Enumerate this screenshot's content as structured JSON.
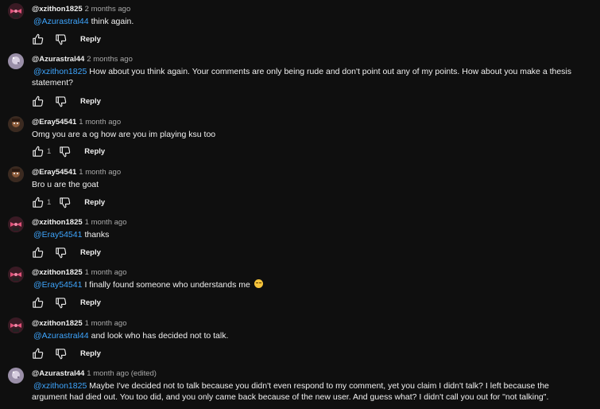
{
  "comments": [
    {
      "author": "@xzithon1825",
      "time": "2 months ago",
      "mention": "@Azurastral44",
      "text": "think again.",
      "likes": "",
      "reply": "Reply",
      "avatar": "pink-bow-avatar"
    },
    {
      "author": "@Azurastral44",
      "time": "2 months ago",
      "mention": "@xzithon1825",
      "text": "How about you think again. Your comments are only being rude and don't point out any of my points. How about you make a thesis statement?",
      "likes": "",
      "reply": "Reply",
      "avatar": "galaxy-avatar"
    },
    {
      "author": "@Eray54541",
      "time": "1 month ago",
      "mention": "",
      "text": "Omg you are a og how are you im playing ksu too",
      "likes": "1",
      "reply": "Reply",
      "avatar": "brown-character-avatar"
    },
    {
      "author": "@Eray54541",
      "time": "1 month ago",
      "mention": "",
      "text": "Bro u are the goat",
      "likes": "1",
      "reply": "Reply",
      "avatar": "brown-character-avatar"
    },
    {
      "author": "@xzithon1825",
      "time": "1 month ago",
      "mention": "@Eray54541",
      "text": "thanks",
      "likes": "",
      "reply": "Reply",
      "avatar": "pink-bow-avatar"
    },
    {
      "author": "@xzithon1825",
      "time": "1 month ago",
      "mention": "@Eray54541",
      "text": "I finally found someone who understands me",
      "emoji": "relieved-face-emoji",
      "likes": "",
      "reply": "Reply",
      "avatar": "pink-bow-avatar"
    },
    {
      "author": "@xzithon1825",
      "time": "1 month ago",
      "mention": "@Azurastral44",
      "text": "and look who has decided not to talk.",
      "likes": "",
      "reply": "Reply",
      "avatar": "pink-bow-avatar"
    },
    {
      "author": "@Azurastral44",
      "time": "1 month ago (edited)",
      "mention": "@xzithon1825",
      "text": "Maybe I've decided not to talk because you didn't even respond to my comment, yet you claim I didn't talk? I left because the argument had died out. You too did, and you only came back because of the new user. And guess what? I didn't call you out for \"not talking\".",
      "likes": "",
      "reply": "Reply",
      "avatar": "galaxy-avatar"
    }
  ],
  "colors": {
    "background": "#0f0f0f",
    "mention": "#3ea6ff",
    "secondary_text": "#aaaaaa"
  },
  "icons": {
    "like": "thumbs-up-icon",
    "dislike": "thumbs-down-icon"
  }
}
